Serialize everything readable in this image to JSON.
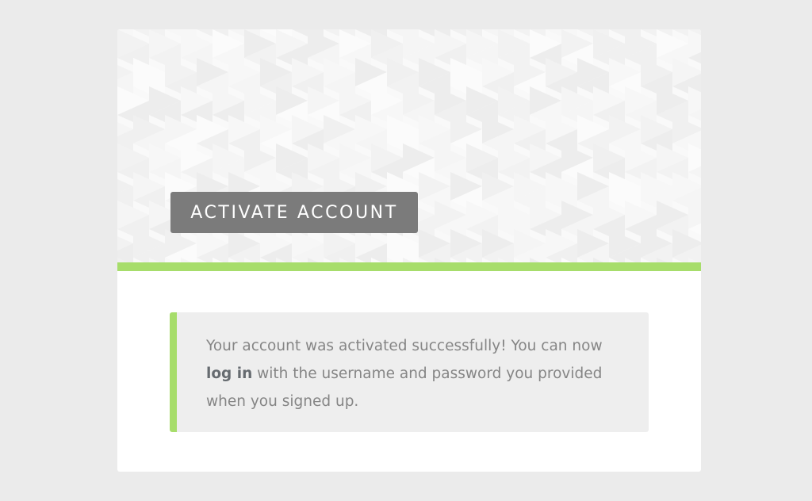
{
  "page": {
    "title": "ACTIVATE ACCOUNT"
  },
  "notice": {
    "text_before": "Your account was activated successfully! You can now ",
    "link_label": "log in",
    "text_after": " with the username and password you provided when you signed up."
  },
  "colors": {
    "page_background": "#ebebeb",
    "card_background": "#ffffff",
    "title_background": "#7b7b7b",
    "accent_green": "#a7dd6b",
    "notice_background": "#eeeeee",
    "notice_text": "#858585",
    "link_text": "#666b70"
  },
  "icons": {
    "hero_background": "triangle-pattern"
  }
}
